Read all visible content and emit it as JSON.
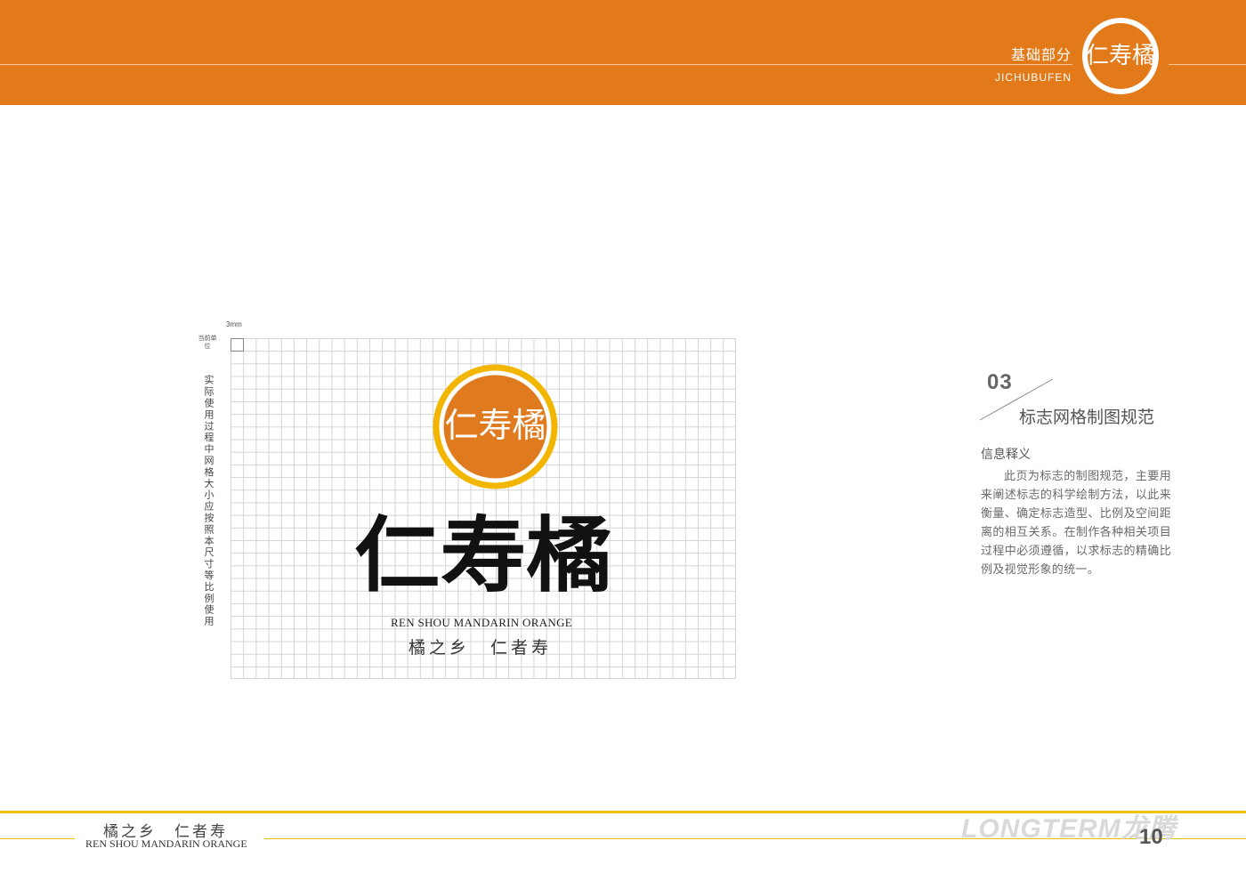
{
  "header": {
    "section_cn": "基础部分",
    "section_en": "JICHUBUFEN",
    "emblem_text": "仁寿橘",
    "accent_color": "#e37a1a"
  },
  "grid": {
    "unit_label": "3mm",
    "unit_cell_label": "当前单位",
    "vertical_note": "实际使用过程中网格大小应按照本尺寸等比例使用"
  },
  "logo": {
    "emblem_text": "仁寿橘",
    "wordmark": "仁寿橘",
    "english_name": "REN SHOU MANDARIN ORANGE",
    "slogan": "橘之乡　仁者寿",
    "emblem_ring_color": "#f2b600",
    "emblem_fill_color": "#e07a1e"
  },
  "info": {
    "section_number": "03",
    "section_title": "标志网格制图规范",
    "heading": "信息释义",
    "body": "此页为标志的制图规范，主要用来阐述标志的科学绘制方法，以此来衡量、确定标志造型、比例及空间距离的相互关系。在制作各种相关项目过程中必须遵循，以求标志的精确比例及视觉形象的统一。"
  },
  "footer": {
    "slogan": "橘之乡　仁者寿",
    "english_name": "REN SHOU MANDARIN ORANGE",
    "brand_watermark": "LONGTERM龙腾",
    "page_number": "10",
    "line_color": "#f2c100"
  }
}
